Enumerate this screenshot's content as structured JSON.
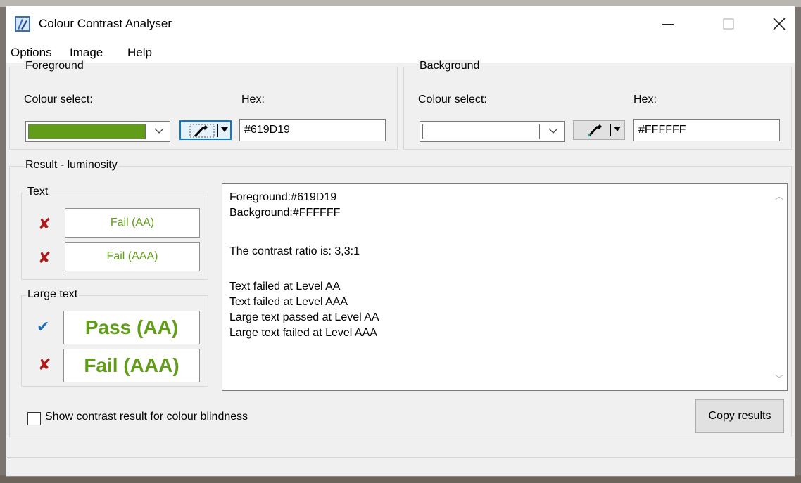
{
  "window": {
    "title": "Colour Contrast Analyser"
  },
  "menu": [
    "Options",
    "Image",
    "Help"
  ],
  "foreground": {
    "group_label": "Foreground",
    "colour_select_label": "Colour select:",
    "hex_label": "Hex:",
    "hex_value": "#619D19",
    "swatch_color": "#619D19"
  },
  "background": {
    "group_label": "Background",
    "colour_select_label": "Colour select:",
    "hex_label": "Hex:",
    "hex_value": "#FFFFFF",
    "swatch_color": "#FFFFFF"
  },
  "result": {
    "group_label": "Result - luminosity",
    "text_group_label": "Text",
    "large_text_group_label": "Large text",
    "text_aa": "Fail (AA)",
    "text_aaa": "Fail (AAA)",
    "large_aa": "Pass (AA)",
    "large_aaa": "Fail (AAA)",
    "report_lines": [
      "Foreground:#619D19",
      "Background:#FFFFFF",
      "",
      "The contrast ratio is: 3,3:1",
      "",
      "Text failed at Level AA",
      "Text failed at Level AAA",
      "Large text passed at Level AA",
      "Large text failed at Level AAA"
    ]
  },
  "colour_blindness_checkbox": "Show contrast result for colour blindness",
  "copy_button": "Copy results",
  "icons": {
    "pass": "checkmark-icon",
    "fail": "cross-icon",
    "picker": "eyedropper-icon"
  }
}
